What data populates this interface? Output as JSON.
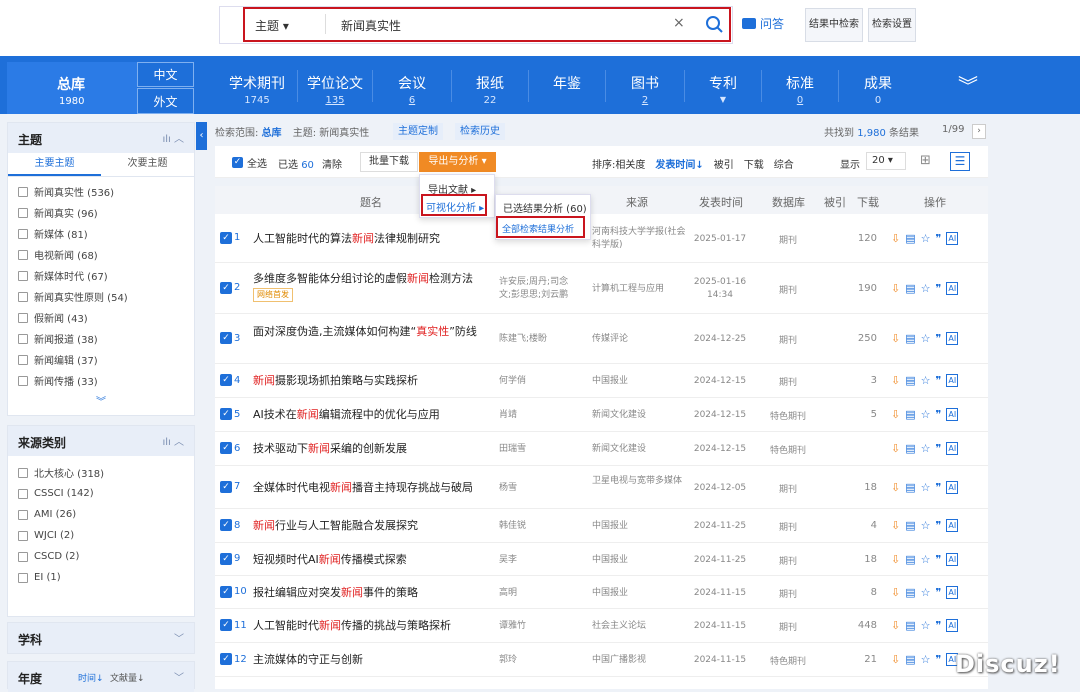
{
  "search": {
    "field": "主题",
    "query": "新闻真实性",
    "ask": "问答",
    "search_in_results": "结果中检索",
    "search_settings": "检索设置"
  },
  "nav": {
    "total": "总库",
    "total_count": "1980",
    "lang_cn": "中文",
    "lang_en": "外文",
    "items": [
      {
        "label": "学术期刊",
        "count": "1745"
      },
      {
        "label": "学位论文",
        "count": "135"
      },
      {
        "label": "会议",
        "count": "6"
      },
      {
        "label": "报纸",
        "count": "22"
      },
      {
        "label": "年鉴",
        "count": ""
      },
      {
        "label": "图书",
        "count": "2"
      },
      {
        "label": "专利",
        "count": ""
      },
      {
        "label": "标准",
        "count": "0"
      },
      {
        "label": "成果",
        "count": "0"
      }
    ]
  },
  "sidebar": {
    "topic": {
      "title": "主题",
      "tab_main": "主要主题",
      "tab_sub": "次要主题",
      "items": [
        "新闻真实性 (536)",
        "新闻真实 (96)",
        "新媒体 (81)",
        "电视新闻 (68)",
        "新媒体时代 (67)",
        "新闻真实性原则 (54)",
        "假新闻 (43)",
        "新闻报道 (38)",
        "新闻编辑 (37)",
        "新闻传播 (33)"
      ]
    },
    "source": {
      "title": "来源类别",
      "items": [
        "北大核心 (318)",
        "CSSCI (142)",
        "AMI (26)",
        "WJCI (2)",
        "CSCD (2)",
        "EI (1)"
      ]
    },
    "subject": {
      "title": "学科"
    },
    "year": {
      "title": "年度",
      "sort_time": "时间↓",
      "sort_count": "文献量↓"
    }
  },
  "toolbar": {
    "scope_label": "检索范围:",
    "scope_value": "总库",
    "topic_label": "主题: 新闻真实性",
    "topic_custom": "主题定制",
    "history": "检索历史",
    "found_prefix": "共找到",
    "found_count": "1,980",
    "found_suffix": "条结果",
    "page": "1/99",
    "select_all": "全选",
    "selected": "已选",
    "selected_count": "60",
    "clear": "清除",
    "batch_download": "批量下载",
    "export_analyze": "导出与分析",
    "sort_label": "排序:",
    "sort_relevance": "相关度",
    "sort_date": "发表时间↓",
    "sort_cite": "被引",
    "sort_download": "下载",
    "sort_composite": "综合",
    "display_label": "显示",
    "display_count": "20"
  },
  "menus": {
    "export_doc": "导出文献",
    "visual_analysis": "可视化分析",
    "selected_analysis": "已选结果分析 (60)",
    "all_analysis": "全部检索结果分析"
  },
  "table": {
    "headers": {
      "title": "题名",
      "source": "来源",
      "date": "发表时间",
      "db": "数据库",
      "cite": "被引",
      "download": "下载",
      "ops": "操作"
    },
    "rows": [
      {
        "n": "1",
        "pre": "人工智能时代的算法",
        "hl": "新闻",
        "post": "法律规制研究",
        "tag": "",
        "author": "",
        "source": "河南科技大学学报(社会科学版)",
        "date": "2025-01-17",
        "db": "期刊",
        "cite": "",
        "dl": "120"
      },
      {
        "n": "2",
        "pre": "多维度多智能体分组讨论的虚假",
        "hl": "新闻",
        "post": "检测方法",
        "tag": "网络首发",
        "author": "许安辰;周丹;司念文;彭思思;刘云鹏",
        "source": "计算机工程与应用",
        "date": "2025-01-16 14:34",
        "db": "期刊",
        "cite": "",
        "dl": "190"
      },
      {
        "n": "3",
        "pre": "面对深度伪造,主流媒体如何构建“",
        "hl": "真实性",
        "post": "”防线",
        "tag": "",
        "author": "陈建飞;楼盼",
        "source": "传媒评论",
        "date": "2024-12-25",
        "db": "期刊",
        "cite": "",
        "dl": "250"
      },
      {
        "n": "4",
        "pre": "",
        "hl": "新闻",
        "post": "摄影现场抓拍策略与实践探析",
        "tag": "",
        "author": "何学俏",
        "source": "中国报业",
        "date": "2024-12-15",
        "db": "期刊",
        "cite": "",
        "dl": "3"
      },
      {
        "n": "5",
        "pre": "AI技术在",
        "hl": "新闻",
        "post": "编辑流程中的优化与应用",
        "tag": "",
        "author": "肖靖",
        "source": "新闻文化建设",
        "date": "2024-12-15",
        "db": "特色期刊",
        "cite": "",
        "dl": "5"
      },
      {
        "n": "6",
        "pre": "技术驱动下",
        "hl": "新闻",
        "post": "采编的创新发展",
        "tag": "",
        "author": "田瑞雪",
        "source": "新闻文化建设",
        "date": "2024-12-15",
        "db": "特色期刊",
        "cite": "",
        "dl": ""
      },
      {
        "n": "7",
        "pre": "全媒体时代电视",
        "hl": "新闻",
        "post": "播音主持现存挑战与破局",
        "tag": "",
        "author": "杨雪",
        "source": "卫星电视与宽带多媒体",
        "date": "2024-12-05",
        "db": "期刊",
        "cite": "",
        "dl": "18"
      },
      {
        "n": "8",
        "pre": "",
        "hl": "新闻",
        "post": "行业与人工智能融合发展探究",
        "tag": "",
        "author": "韩佳锐",
        "source": "中国报业",
        "date": "2024-11-25",
        "db": "期刊",
        "cite": "",
        "dl": "4"
      },
      {
        "n": "9",
        "pre": "短视频时代AI",
        "hl": "新闻",
        "post": "传播模式探索",
        "tag": "",
        "author": "吴李",
        "source": "中国报业",
        "date": "2024-11-25",
        "db": "期刊",
        "cite": "",
        "dl": "18"
      },
      {
        "n": "10",
        "pre": "报社编辑应对突发",
        "hl": "新闻",
        "post": "事件的策略",
        "tag": "",
        "author": "高明",
        "source": "中国报业",
        "date": "2024-11-15",
        "db": "期刊",
        "cite": "",
        "dl": "8"
      },
      {
        "n": "11",
        "pre": "人工智能时代",
        "hl": "新闻",
        "post": "传播的挑战与策略探析",
        "tag": "",
        "author": "谭雅竹",
        "source": "社会主义论坛",
        "date": "2024-11-15",
        "db": "期刊",
        "cite": "",
        "dl": "448"
      },
      {
        "n": "12",
        "pre": "主流媒体的守正与创新",
        "hl": "",
        "post": "",
        "tag": "",
        "author": "郭玲",
        "source": "中国广播影视",
        "date": "2024-11-15",
        "db": "特色期刊",
        "cite": "",
        "dl": "21"
      }
    ]
  },
  "watermark": "Discuz!"
}
